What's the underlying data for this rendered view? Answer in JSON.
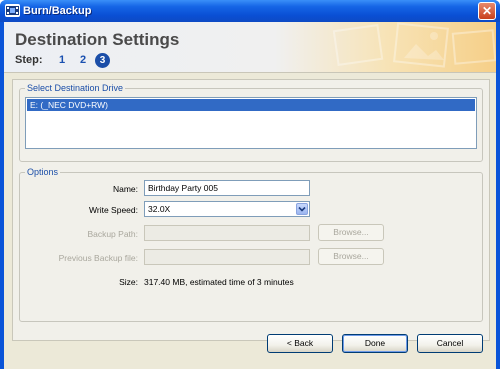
{
  "window": {
    "title": "Burn/Backup",
    "close_glyph": "✕"
  },
  "header": {
    "title": "Destination Settings",
    "step_label": "Step:",
    "steps": [
      "1",
      "2",
      "3"
    ],
    "current_step": "3"
  },
  "drive_group": {
    "legend": "Select Destination Drive",
    "items": [
      "E: (_NEC DVD+RW)"
    ],
    "selected": "E: (_NEC DVD+RW)"
  },
  "options": {
    "legend": "Options",
    "name_label": "Name:",
    "name_value": "Birthday Party 005",
    "write_speed_label": "Write Speed:",
    "write_speed_value": "32.0X",
    "backup_path_label": "Backup Path:",
    "backup_path_value": "",
    "previous_backup_label": "Previous Backup file:",
    "previous_backup_value": "",
    "browse_label": "Browse...",
    "size_label": "Size:",
    "size_value": "317.40 MB, estimated time of 3 minutes"
  },
  "buttons": {
    "back": "< Back",
    "done": "Done",
    "cancel": "Cancel"
  },
  "colors": {
    "titlebar": "#0a54d8",
    "accent": "#1b4ea8",
    "selection": "#316ac5",
    "client_bg": "#ece9d8"
  },
  "icons": {
    "app": "film-strip-icon",
    "close": "close-icon",
    "dropdown": "chevron-down-icon"
  }
}
